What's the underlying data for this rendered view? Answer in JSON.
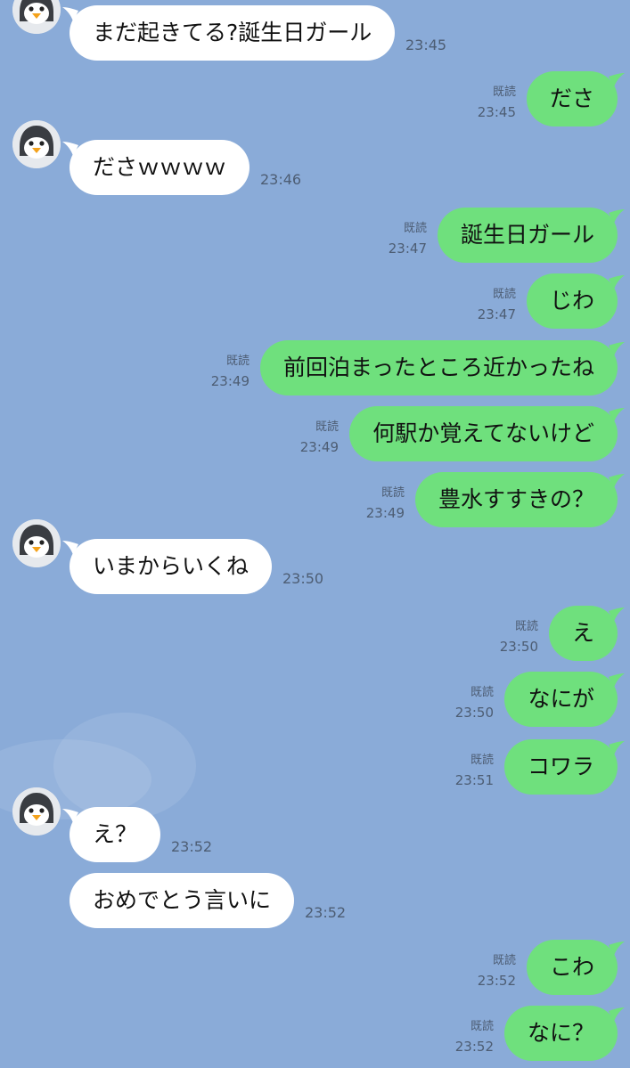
{
  "colors": {
    "background": "#8aabd8",
    "incoming_bubble": "#ffffff",
    "outgoing_bubble": "#6fe07d"
  },
  "contact": {
    "avatar_icon": "penguin-icon"
  },
  "read_label": "既読",
  "messages": [
    {
      "dir": "in",
      "text": "まだ起きてる?誕生日ガール",
      "time": "23:45",
      "avatar": true
    },
    {
      "dir": "out",
      "text": "ださ",
      "time": "23:45",
      "read": true
    },
    {
      "dir": "in",
      "text": "ださｗｗｗｗ",
      "time": "23:46",
      "avatar": true
    },
    {
      "dir": "out",
      "text": "誕生日ガール",
      "time": "23:47",
      "read": true
    },
    {
      "dir": "out",
      "text": "じわ",
      "time": "23:47",
      "read": true
    },
    {
      "dir": "out",
      "text": "前回泊まったところ近かったね",
      "time": "23:49",
      "read": true
    },
    {
      "dir": "out",
      "text": "何駅か覚えてないけど",
      "time": "23:49",
      "read": true
    },
    {
      "dir": "out",
      "text": "豊水すすきの？",
      "time": "23:49",
      "read": true
    },
    {
      "dir": "in",
      "text": "いまからいくね",
      "time": "23:50",
      "avatar": true
    },
    {
      "dir": "out",
      "text": "え",
      "time": "23:50",
      "read": true
    },
    {
      "dir": "out",
      "text": "なにが",
      "time": "23:50",
      "read": true
    },
    {
      "dir": "out",
      "text": "コワラ",
      "time": "23:51",
      "read": true
    },
    {
      "dir": "in",
      "text": "え？",
      "time": "23:52",
      "avatar": true
    },
    {
      "dir": "in",
      "text": "おめでとう言いに",
      "time": "23:52",
      "avatar": false
    },
    {
      "dir": "out",
      "text": "こわ",
      "time": "23:52",
      "read": true
    },
    {
      "dir": "out",
      "text": "なに？",
      "time": "23:52",
      "read": true
    }
  ]
}
